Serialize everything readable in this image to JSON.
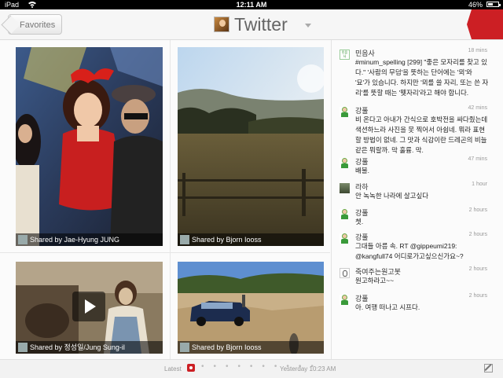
{
  "status_bar": {
    "carrier": "iPad",
    "time": "12:11 AM",
    "battery_percent": "46%",
    "battery_level": 0.46
  },
  "top_bar": {
    "back_button_label": "Favorites",
    "title": "Twitter",
    "accent_color": "#cc1f24"
  },
  "photos": [
    {
      "credit": "Shared by Jae-Hyung JUNG",
      "is_video": false
    },
    {
      "credit": "Shared by Bjorn Iooss",
      "is_video": false
    },
    {
      "credit": "Shared by 정성일/Jung Sung-il",
      "is_video": true
    },
    {
      "credit": "Shared by Bjorn Iooss",
      "is_video": false
    }
  ],
  "feed": [
    {
      "name": "민음사",
      "time": "18 mins",
      "avatar_text": "민음사",
      "text": "#minum_spelling [299] \"좋은 모자리를 찾고 있다.\" '사람의 무덤'을 뜻하는 단어에는 '뫼'와 '묘'가 있습니다. 하지만 '뫼를 쓸 자리, 또는 쓴 자리'를 뜻할 때는 '뭿자리'라고 해야 합니다."
    },
    {
      "name": "강풀",
      "time": "42 mins",
      "text": "비 온다고 아내가 간식으로 호박전을 싸다줬는데 색션하느라 사진을 못 찍어서 아쉽네. 뭐라 표현할 방법이 없네. 그 맛과 식감이란 드레곤의 비늘같은 뭐랄까. 막 훌륭. 막."
    },
    {
      "name": "강풀",
      "time": "47 mins",
      "text": "배불."
    },
    {
      "name": "라하",
      "time": "1 hour",
      "text": "안 녹녹한 나라에 살고싶다"
    },
    {
      "name": "강풀",
      "time": "2 hours",
      "text": "쳇."
    },
    {
      "name": "강풀",
      "time": "2 hours",
      "text": "그대들 아름 속. RT @gippeumi219: @kangfull74 어디로가고싶으신가요~?"
    },
    {
      "name": "죽여주는원고봇",
      "time": "2 hours",
      "text": "원고하라고~~"
    },
    {
      "name": "강풀",
      "time": "2 hours",
      "text": "아. 여행 떠나고 시프다."
    }
  ],
  "bottom_bar": {
    "latest_label": "Latest",
    "date_label": "Yesterday 10:23 AM",
    "dots": "• • • • • • • • • •"
  }
}
